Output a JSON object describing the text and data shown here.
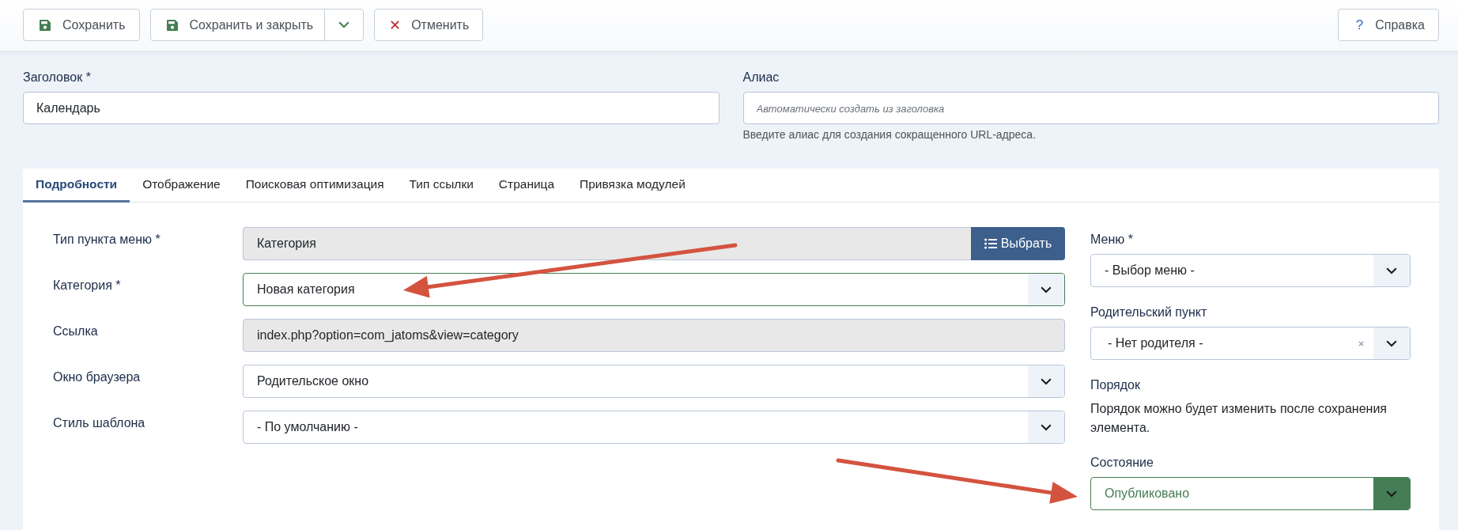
{
  "toolbar": {
    "buttons": [
      {
        "kind": "save",
        "label": "Сохранить"
      },
      {
        "kind": "save-split",
        "label": "Сохранить и закрыть"
      },
      {
        "kind": "cancel",
        "label": "Отменить"
      }
    ],
    "help": {
      "icon": "?",
      "label": "Справка"
    }
  },
  "title_field": {
    "label": "Заголовок *",
    "value": "Календарь"
  },
  "alias_field": {
    "label": "Алиас",
    "placeholder": "Автоматически создать из заголовка",
    "hint": "Введите алиас для создания сокращенного URL-адреса."
  },
  "tabs": [
    {
      "label": "Подробности",
      "selected": true
    },
    {
      "label": "Отображение",
      "selected": false
    },
    {
      "label": "Поисковая оптимизация",
      "selected": false
    },
    {
      "label": "Тип ссылки",
      "selected": false
    },
    {
      "label": "Страница",
      "selected": false
    },
    {
      "label": "Привязка модулей",
      "selected": false
    }
  ],
  "details": {
    "fields": [
      {
        "kind": "picker",
        "label": "Тип пункта меню *",
        "value": "Категория",
        "button": "Выбрать",
        "valid": false
      },
      {
        "kind": "select",
        "label": "Категория *",
        "value": "Новая категория",
        "valid": true
      },
      {
        "kind": "readonly",
        "label": "Ссылка",
        "value": "index.php?option=com_jatoms&view=category",
        "valid": false
      },
      {
        "kind": "select",
        "label": "Окно браузера",
        "value": "Родительское окно",
        "valid": false
      },
      {
        "kind": "select",
        "label": "Стиль шаблона",
        "value": "- По умолчанию -",
        "valid": false
      }
    ]
  },
  "sidebar": {
    "fields": [
      {
        "kind": "select",
        "label": "Меню *",
        "value": "- Выбор меню -",
        "valid": false
      },
      {
        "kind": "clearable-select",
        "label": "Родительский пункт",
        "value": "- Нет родителя -",
        "valid": false
      },
      {
        "kind": "note",
        "label": "Порядок",
        "text": "Порядок можно будет изменить после сохранения элемента."
      },
      {
        "kind": "status",
        "label": "Состояние",
        "value": "Опубликовано",
        "valid": true
      }
    ]
  }
}
